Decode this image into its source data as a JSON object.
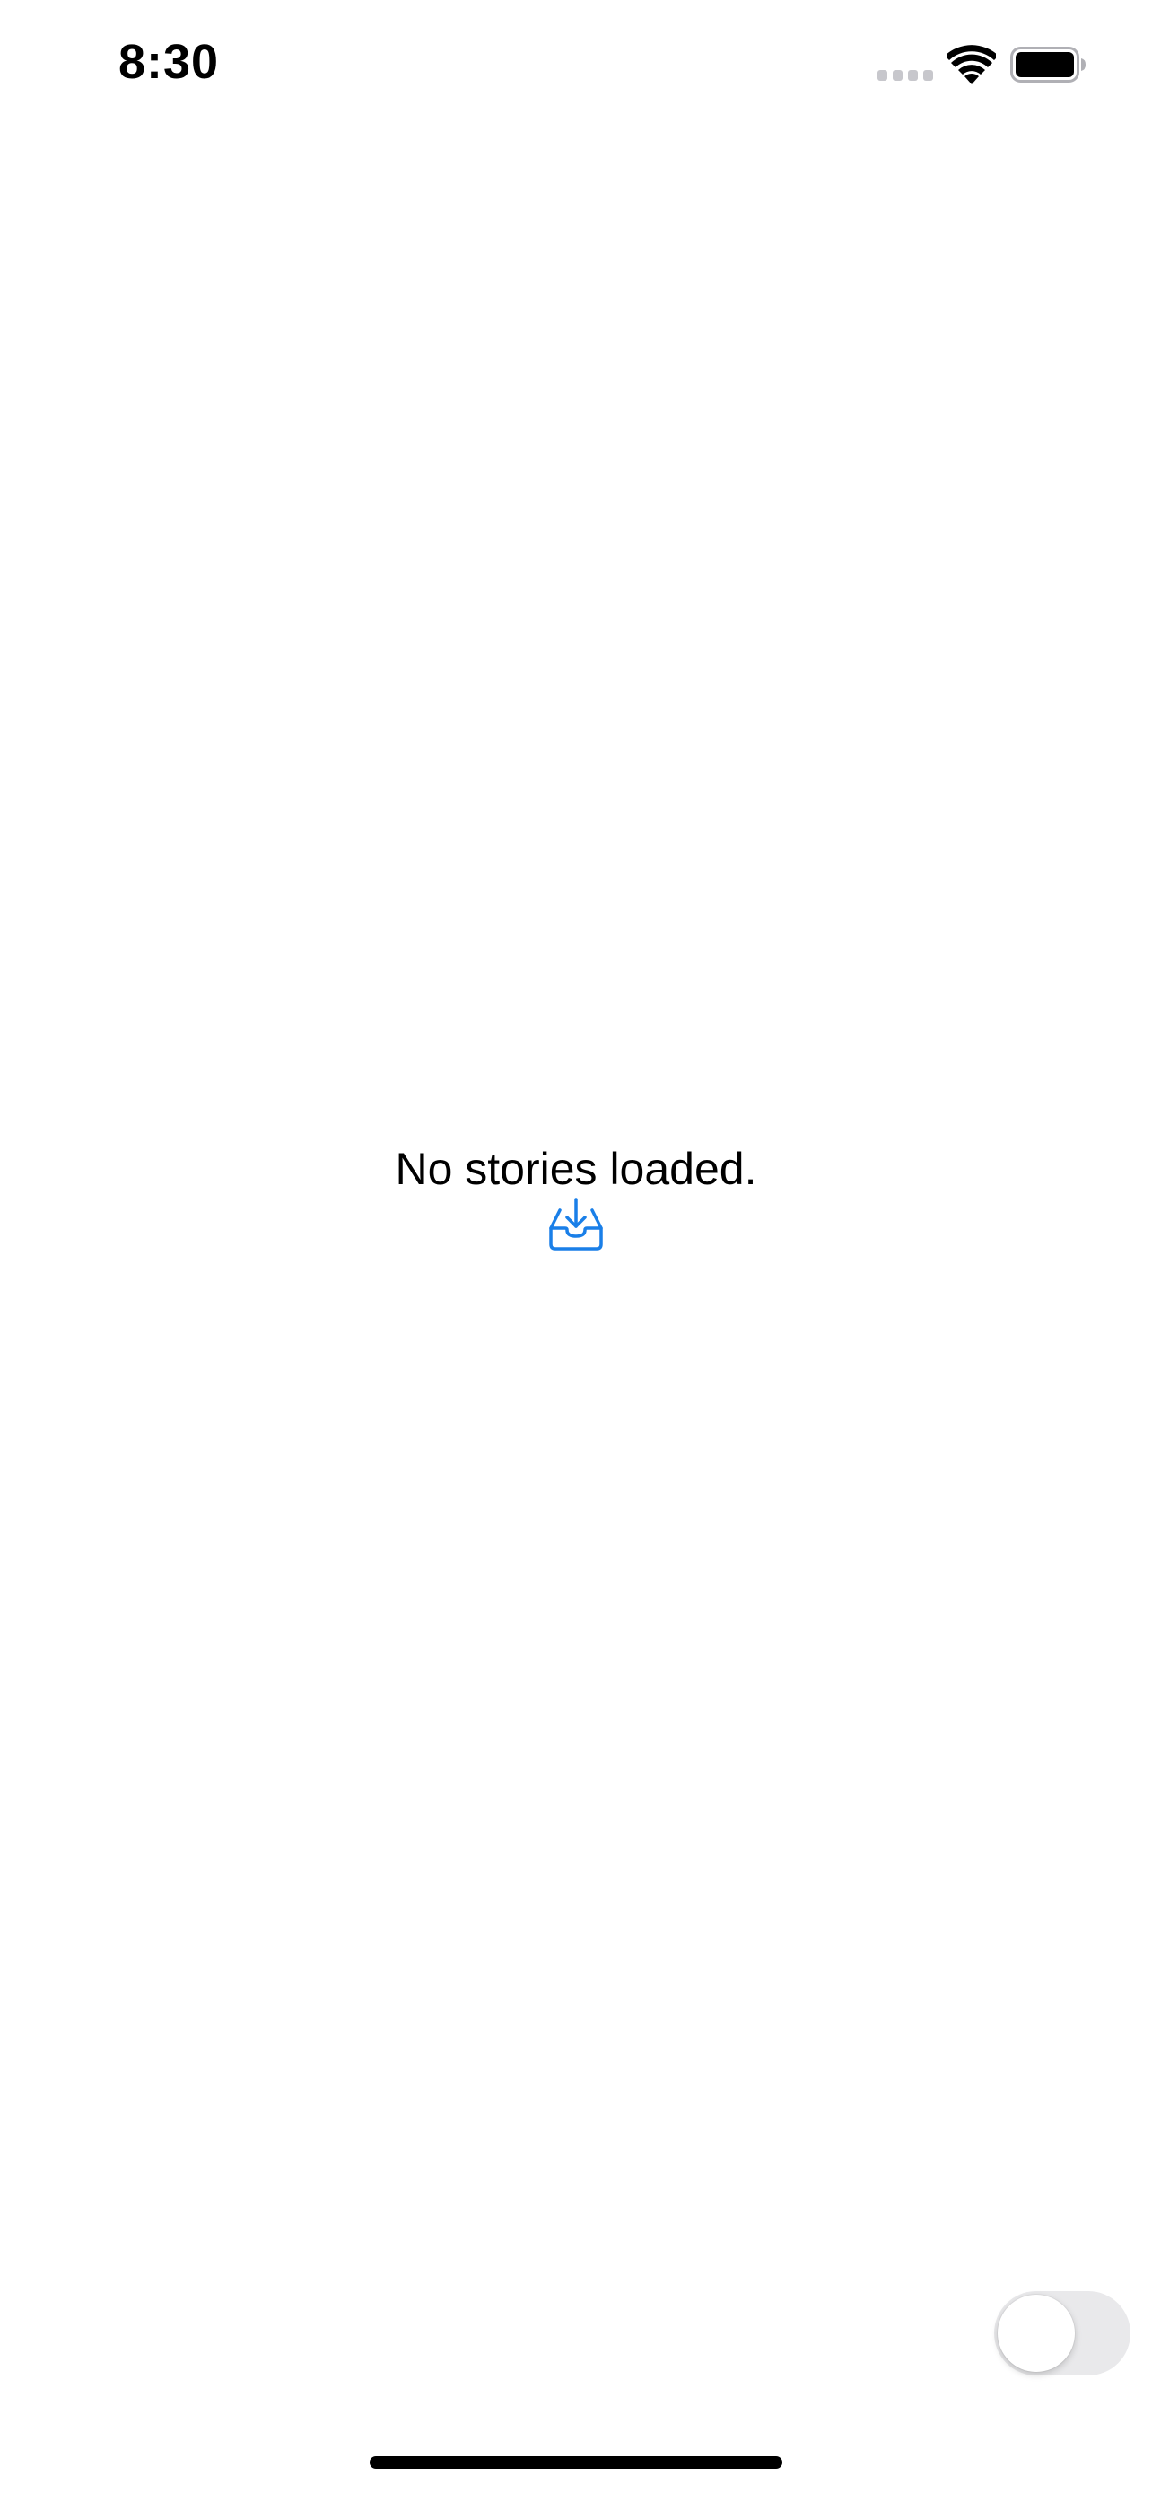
{
  "status_bar": {
    "time": "8:30",
    "icons": [
      "cellular-signal-icon",
      "wifi-icon",
      "battery-icon"
    ]
  },
  "empty_state": {
    "message": "No stories loaded.",
    "action_icon": "tray-download-icon"
  },
  "toggle": {
    "state": "off"
  },
  "colors": {
    "accent": "#1a7fe8",
    "text": "#000000",
    "toggle_track_off": "#e9e9eb",
    "background": "#ffffff"
  }
}
